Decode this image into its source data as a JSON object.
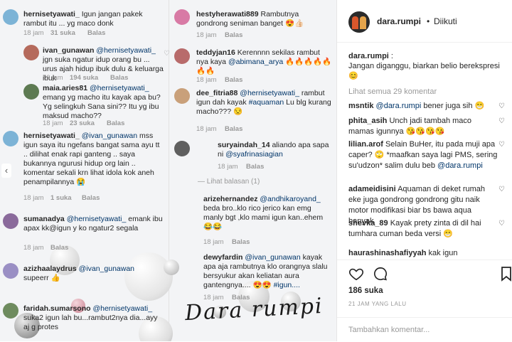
{
  "image": {
    "comments": [
      {
        "user": "hernisetyawati_",
        "text": "Igun jangan pakek rambut itu ... yg maco donk",
        "time": "18 jam",
        "likes": "31 suka",
        "reply": "Balas"
      },
      {
        "user": "ivan_gunawan",
        "mention": "@hernisetyawati_",
        "text": "jgn suka ngatur idup orang bu ... urus ajah hidup ibuk dulu & keluarga ibuk",
        "time": "18 jam",
        "likes": "194 suka",
        "reply": "Balas"
      },
      {
        "user": "maia.aries81",
        "mention": "@hernisetyawati_",
        "text": "emang yg macho itu kayak apa bu? Yg selingkuh Sana sini?? Itu yg ibu maksud macho??",
        "time": "18 jam",
        "likes": "23 suka",
        "reply": "Balas"
      },
      {
        "user": "hernisetyawati_",
        "mention": "@ivan_gunawan",
        "text": "mss igun saya itu ngefans  bangat sama ayu tt .. dilihat enak rapi ganteng .. saya bukannya ngurusi hidup org lain .. komentar sekali krn lihat idola kok aneh penampilannya",
        "emoji": "😭",
        "time": "18 jam",
        "likes": "1 suka",
        "reply": "Balas"
      },
      {
        "user": "sumanadya",
        "mention": "@hernisetyawati_",
        "text": "emank ibu apax kk@igun y ko ngatur2 segala",
        "time": "18 jam",
        "reply": "Balas"
      },
      {
        "user": "azizhaalaydrus",
        "mention": "@ivan_gunawan",
        "text": "supeerr",
        "emoji": "👍"
      },
      {
        "user": "faridah.sumarsono",
        "mention": "@hernisetyawati_",
        "text": "suka2 igun lah bu...rambut2nya dia...ayy aj g protes"
      },
      {
        "user": "hestyherawati889",
        "text": "Rambutnya gondrong seniman banget",
        "emoji": "😍👍🏻",
        "time": "18 jam",
        "reply": "Balas"
      },
      {
        "user": "teddyjan16",
        "text": "Kerennnn sekilas rambut nya kaya",
        "mention": "@abimana_arya",
        "emoji": "🔥🔥🔥🔥🔥🔥🔥",
        "time": "18 jam",
        "reply": "Balas"
      },
      {
        "user": "dee_fitria88",
        "mention": "@hernisetyawati_",
        "text": "rambut igun dah kayak",
        "mention2": "#aquaman",
        "text2": "Lu blg kurang macho???",
        "emoji": "😒",
        "time": "18 jam",
        "reply": "Balas"
      },
      {
        "user": "suryaindah_14",
        "text": "aliando apa sapa ni",
        "mention": "@syafrinasiagian",
        "time": "18 jam",
        "reply": "Balas"
      },
      {
        "replies": "Lihat balasan (1)"
      },
      {
        "user": "arizehernandez",
        "mention": "@andhikaroyand_",
        "text": "beda bro..klo rico jerico kan emg manly bgt ,klo mami igun kan..ehem",
        "emoji": "😂😂",
        "time": "18 jam",
        "reply": "Balas"
      },
      {
        "user": "dewyfardin",
        "mention": "@ivan_gunawan",
        "text": "kayak apa aja rambutnya klo orangnya slalu bersyukur akan keliatan aura gantengnya....",
        "emoji": "😍😍",
        "mention2": "#igun....",
        "time": "18 jam",
        "reply": "Balas"
      }
    ],
    "signature": "Dara rumpi"
  },
  "panel": {
    "header": {
      "username": "dara.rumpi",
      "dot": "•",
      "follow": "Diikuti"
    },
    "caption": {
      "username": "dara.rumpi",
      "text": "Jangan diganggu, biarkan belio berekspresi",
      "emoji": "😊"
    },
    "view_all": "Lihat semua 29 komentar",
    "comments": [
      {
        "user": "msntik",
        "mention": "@dara.rumpi",
        "text": "bener juga sih",
        "emoji": "😁"
      },
      {
        "user": "phita_asih",
        "text": "Unch jadi tambah maco mamas igunnya",
        "emoji": "😘😘😘😘"
      },
      {
        "user": "lilian.arof",
        "text": "Selain BuHer, itu pada muji apa caper?",
        "emoji": "🙄",
        "text2": "*maafkan saya lagi PMS, sering su'udzon* salim dulu beb",
        "mention": "@dara.rumpi"
      },
      {
        "user": "adameidisini",
        "text": "Aquaman di deket rumah eke juga gondrong gondrong gitu naik motor modifikasi biar bs bawa aqua banyak"
      },
      {
        "user": "shevka_89",
        "text": "Kayak prety zinta di dil hai tumhara cuman beda versi",
        "emoji": "😁"
      },
      {
        "user": "haurashinashafiyyah",
        "text": "kak igun"
      }
    ],
    "likes": "186 suka",
    "time": "21 JAM YANG LALU",
    "add_comment_placeholder": "Tambahkan komentar..."
  },
  "colors": {
    "mention": "#003569",
    "muted": "#999999",
    "text": "#262626"
  }
}
